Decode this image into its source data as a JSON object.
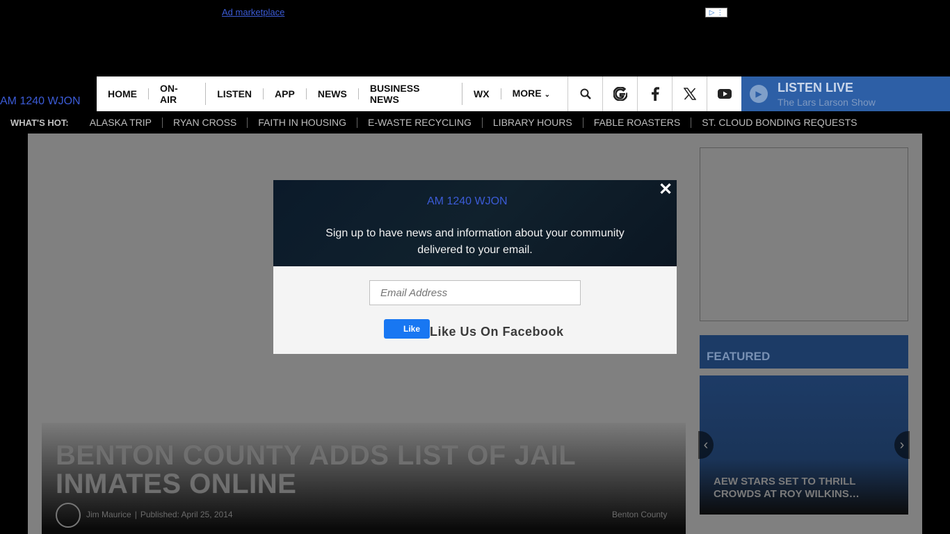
{
  "ad": {
    "top_alt": "Ad marketplace",
    "choices_icons": "▷ ⋮"
  },
  "site": {
    "logo_alt": "AM 1240 WJON"
  },
  "nav": {
    "items": [
      {
        "label": "HOME"
      },
      {
        "label": "ON-AIR"
      },
      {
        "label": "LISTEN"
      },
      {
        "label": "APP"
      },
      {
        "label": "NEWS"
      },
      {
        "label": "BUSINESS NEWS"
      },
      {
        "label": "WX"
      },
      {
        "label": "MORE"
      }
    ],
    "icons": [
      "search-icon",
      "google-icon",
      "facebook-icon",
      "x-icon",
      "youtube-icon"
    ]
  },
  "listen_live": {
    "title": "LISTEN LIVE",
    "show": "The Lars Larson Show"
  },
  "whats_hot": {
    "label": "WHAT'S HOT:",
    "items": [
      "ALASKA TRIP",
      "RYAN CROSS",
      "FAITH IN HOUSING",
      "E-WASTE RECYCLING",
      "LIBRARY HOURS",
      "FABLE ROASTERS",
      "ST. CLOUD BONDING REQUESTS"
    ]
  },
  "article": {
    "title": "BENTON COUNTY ADDS LIST OF JAIL INMATES ONLINE",
    "author": "Jim Maurice",
    "published": "Published: April 25, 2014",
    "tag": "Benton County"
  },
  "sidebar": {
    "featured_header": "FEATURED",
    "featured_title": "AEW STARS SET TO THRILL CROWDS AT ROY WILKINS…"
  },
  "modal": {
    "logo_alt": "AM 1240 WJON",
    "text_line1": "Sign up to have news and information about your community",
    "text_line2": "delivered to your email.",
    "email_placeholder": "Email Address",
    "fb_like": "Like",
    "fb_label": "Like Us On Facebook",
    "close": "✕"
  }
}
